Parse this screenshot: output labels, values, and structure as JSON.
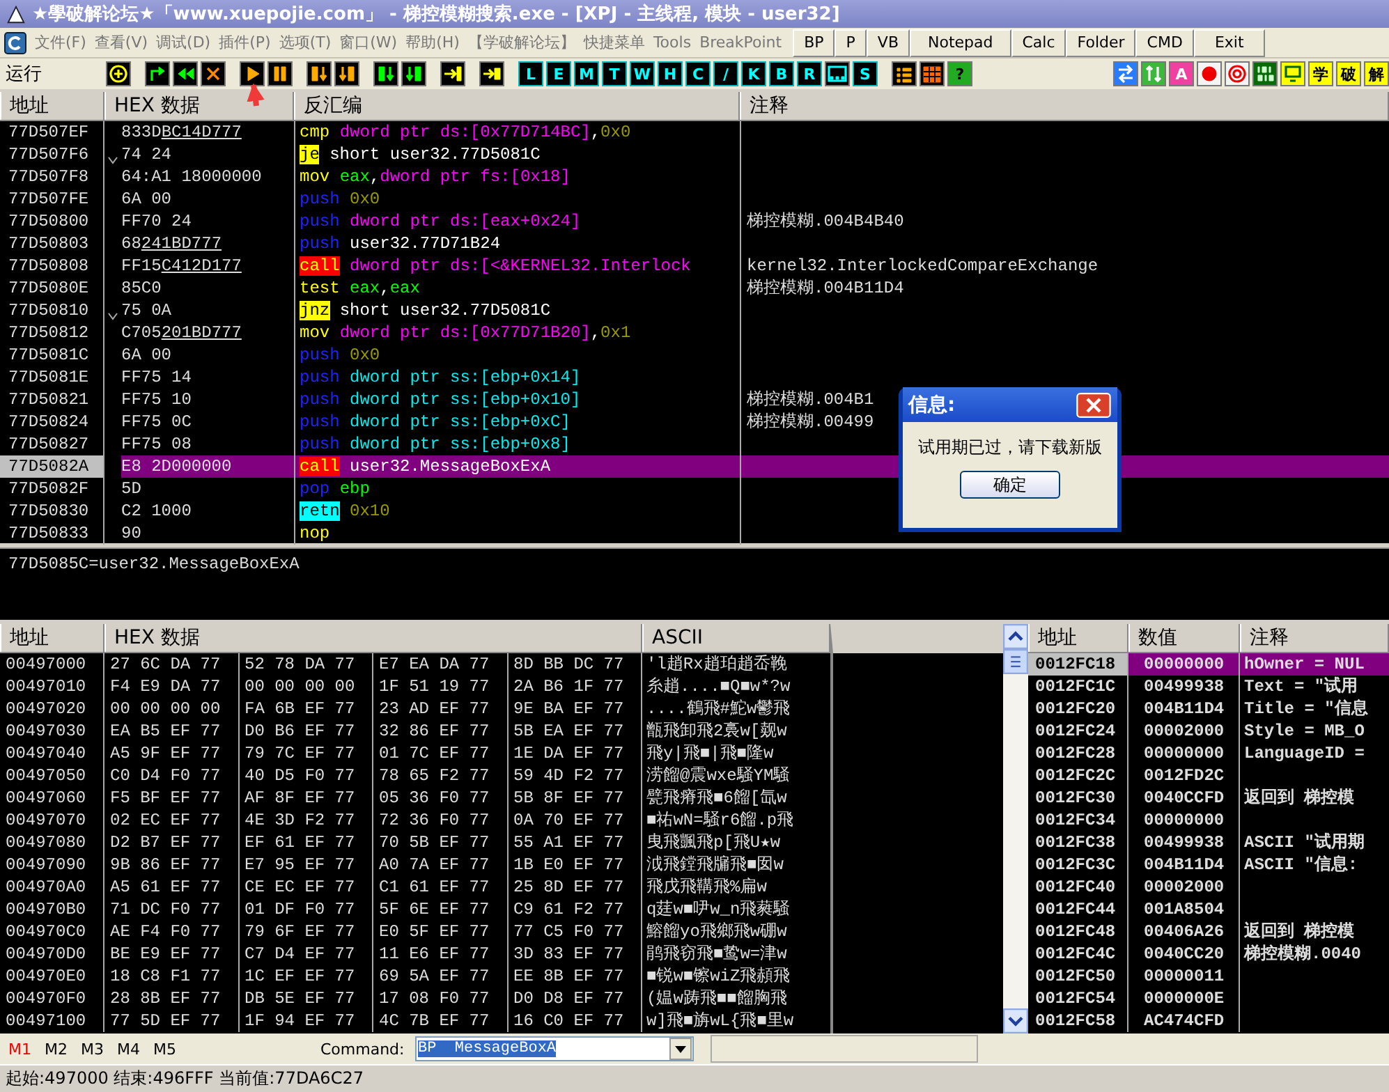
{
  "window": {
    "title": "★學破解论坛★「www.xuepojie.com」 - 梯控模糊搜索.exe - [XPJ - 主线程, 模块 - user32]"
  },
  "menu": {
    "items": [
      "文件(F)",
      "查看(V)",
      "调试(D)",
      "插件(P)",
      "选项(T)",
      "窗口(W)",
      "帮助(H)",
      "【学破解论坛】",
      "快捷菜单",
      "Tools",
      "BreakPoint"
    ],
    "buttons": [
      "BP",
      "P",
      "VB",
      "Notepad",
      "Calc",
      "Folder",
      "CMD",
      "Exit"
    ]
  },
  "toolbar": {
    "label": "运行",
    "groups": [
      [
        {
          "kind": "plus"
        }
      ],
      [
        {
          "kind": "restart"
        },
        {
          "kind": "rewind"
        },
        {
          "kind": "close"
        }
      ],
      [
        {
          "kind": "play"
        },
        {
          "kind": "pause"
        }
      ],
      [
        {
          "kind": "stepin"
        },
        {
          "kind": "stepover"
        }
      ],
      [
        {
          "kind": "tracein"
        },
        {
          "kind": "traceover"
        }
      ],
      [
        {
          "kind": "return"
        }
      ],
      [
        {
          "kind": "goto"
        }
      ],
      [
        {
          "kind": "letter",
          "label": "L"
        },
        {
          "kind": "letter",
          "label": "E"
        },
        {
          "kind": "letter",
          "label": "M"
        },
        {
          "kind": "letter",
          "label": "T"
        },
        {
          "kind": "letter",
          "label": "W"
        },
        {
          "kind": "letter",
          "label": "H"
        },
        {
          "kind": "letter",
          "label": "C"
        },
        {
          "kind": "letter",
          "label": "/"
        },
        {
          "kind": "letter",
          "label": "K"
        },
        {
          "kind": "letter",
          "label": "B"
        },
        {
          "kind": "letter",
          "label": "R"
        },
        {
          "kind": "dots"
        },
        {
          "kind": "letter",
          "label": "S"
        }
      ],
      [
        {
          "kind": "list"
        },
        {
          "kind": "grid"
        },
        {
          "kind": "help",
          "label": "?"
        }
      ]
    ],
    "right": [
      {
        "kind": "swap"
      },
      {
        "kind": "updown"
      },
      {
        "kind": "badge",
        "label": "A"
      },
      {
        "kind": "record"
      },
      {
        "kind": "target"
      },
      {
        "kind": "binary"
      },
      {
        "kind": "monitor"
      },
      {
        "kind": "glyph",
        "label": "学"
      },
      {
        "kind": "glyph",
        "label": "破"
      },
      {
        "kind": "glyph",
        "label": "解"
      }
    ]
  },
  "disasm": {
    "columns": [
      "地址",
      "HEX 数据",
      "反汇编",
      "注释"
    ],
    "rows": [
      {
        "addr": "77D507EF",
        "hex": "833D",
        "fixup": "BC14D777",
        "jump_mark": false,
        "selected": false,
        "asm": [
          {
            "kind": "op",
            "text": "cmp"
          },
          {
            "kind": "mem",
            "text": "dword ptr ds:[0x77D714BC]"
          },
          {
            "kind": "sep",
            "text": ","
          },
          {
            "kind": "imm",
            "text": "0x0"
          }
        ]
      },
      {
        "addr": "77D507F6",
        "hex": "74 24",
        "jump_mark": true,
        "selected": false,
        "asm": [
          {
            "kind": "jcc",
            "text": "je"
          },
          {
            "kind": "sym",
            "text": "short user32.77D5081C"
          }
        ]
      },
      {
        "addr": "77D507F8",
        "hex": "64:A1 18000000",
        "jump_mark": false,
        "selected": false,
        "asm": [
          {
            "kind": "op",
            "text": "mov"
          },
          {
            "kind": "reg",
            "text": "eax"
          },
          {
            "kind": "sep",
            "text": ","
          },
          {
            "kind": "mem",
            "text": "dword ptr fs:[0x18]"
          }
        ]
      },
      {
        "addr": "77D507FE",
        "hex": "6A 00",
        "jump_mark": false,
        "selected": false,
        "asm": [
          {
            "kind": "push",
            "text": "push"
          },
          {
            "kind": "imm",
            "text": "0x0"
          }
        ]
      },
      {
        "addr": "77D50800",
        "hex": "FF70 24",
        "jump_mark": false,
        "selected": false,
        "asm": [
          {
            "kind": "push",
            "text": "push"
          },
          {
            "kind": "mem",
            "text": "dword ptr ds:[eax+0x24]"
          }
        ],
        "comment": "梯控模糊.004B4B40"
      },
      {
        "addr": "77D50803",
        "hex": "68",
        "fixup": "241BD777",
        "jump_mark": false,
        "selected": false,
        "asm": [
          {
            "kind": "push",
            "text": "push"
          },
          {
            "kind": "sym",
            "text": "user32.77D71B24"
          }
        ]
      },
      {
        "addr": "77D50808",
        "hex": "FF15",
        "fixup": "C412D177",
        "jump_mark": false,
        "selected": false,
        "asm": [
          {
            "kind": "call",
            "text": "call"
          },
          {
            "kind": "mem",
            "text": "dword ptr ds:[<&KERNEL32.Interlock"
          }
        ],
        "comment": "kernel32.InterlockedCompareExchange"
      },
      {
        "addr": "77D5080E",
        "hex": "85C0",
        "jump_mark": false,
        "selected": false,
        "asm": [
          {
            "kind": "op",
            "text": "test"
          },
          {
            "kind": "reg",
            "text": "eax"
          },
          {
            "kind": "sep",
            "text": ","
          },
          {
            "kind": "reg",
            "text": "eax"
          }
        ],
        "comment": "梯控模糊.004B11D4"
      },
      {
        "addr": "77D50810",
        "hex": "75 0A",
        "jump_mark": true,
        "selected": false,
        "asm": [
          {
            "kind": "jcc",
            "text": "jnz"
          },
          {
            "kind": "sym",
            "text": "short user32.77D5081C"
          }
        ]
      },
      {
        "addr": "77D50812",
        "hex": "C705",
        "fixup": "201BD777",
        "jump_mark": false,
        "selected": false,
        "asm": [
          {
            "kind": "op",
            "text": "mov"
          },
          {
            "kind": "mem",
            "text": "dword ptr ds:[0x77D71B20]"
          },
          {
            "kind": "sep",
            "text": ","
          },
          {
            "kind": "imm",
            "text": "0x1"
          }
        ]
      },
      {
        "addr": "77D5081C",
        "hex": "6A 00",
        "jump_mark": false,
        "selected": false,
        "asm": [
          {
            "kind": "push",
            "text": "push"
          },
          {
            "kind": "imm",
            "text": "0x0"
          }
        ]
      },
      {
        "addr": "77D5081E",
        "hex": "FF75 14",
        "jump_mark": false,
        "selected": false,
        "asm": [
          {
            "kind": "push",
            "text": "push"
          },
          {
            "kind": "stk",
            "text": "dword ptr ss:[ebp+0x14]"
          }
        ]
      },
      {
        "addr": "77D50821",
        "hex": "FF75 10",
        "jump_mark": false,
        "selected": false,
        "asm": [
          {
            "kind": "push",
            "text": "push"
          },
          {
            "kind": "stk",
            "text": "dword ptr ss:[ebp+0x10]"
          }
        ],
        "comment": "梯控模糊.004B1"
      },
      {
        "addr": "77D50824",
        "hex": "FF75 0C",
        "jump_mark": false,
        "selected": false,
        "asm": [
          {
            "kind": "push",
            "text": "push"
          },
          {
            "kind": "stk",
            "text": "dword ptr ss:[ebp+0xC]"
          }
        ],
        "comment": "梯控模糊.00499"
      },
      {
        "addr": "77D50827",
        "hex": "FF75 08",
        "jump_mark": false,
        "selected": false,
        "asm": [
          {
            "kind": "push",
            "text": "push"
          },
          {
            "kind": "stk",
            "text": "dword ptr ss:[ebp+0x8]"
          }
        ]
      },
      {
        "addr": "77D5082A",
        "hex": "E8 2D000000",
        "jump_mark": false,
        "selected": true,
        "asm": [
          {
            "kind": "call",
            "text": "call"
          },
          {
            "kind": "sym",
            "text": "user32.MessageBoxExA"
          }
        ]
      },
      {
        "addr": "77D5082F",
        "hex": "5D",
        "jump_mark": false,
        "selected": false,
        "asm": [
          {
            "kind": "push",
            "text": "pop"
          },
          {
            "kind": "reg",
            "text": "ebp"
          }
        ]
      },
      {
        "addr": "77D50830",
        "hex": "C2 1000",
        "jump_mark": false,
        "selected": false,
        "asm": [
          {
            "kind": "ret",
            "text": "retn"
          },
          {
            "kind": "imm",
            "text": "0x10"
          }
        ]
      },
      {
        "addr": "77D50833",
        "hex": "90",
        "jump_mark": false,
        "selected": false,
        "asm": [
          {
            "kind": "op",
            "text": "nop"
          }
        ]
      }
    ]
  },
  "info": "77D5085C=user32.MessageBoxExA",
  "dump": {
    "columns": [
      "地址",
      "HEX 数据",
      "ASCII"
    ],
    "rows": [
      {
        "addr": "00497000",
        "groups": [
          "27 6C DA 77",
          "52 78 DA 77",
          "E7 EA DA 77",
          "8D BB DC 77"
        ],
        "ascii": "'l趙Rx趙珀趙岙鞔"
      },
      {
        "addr": "00497010",
        "groups": [
          "F4 E9 DA 77",
          "00 00 00 00",
          "1F 51 19 77",
          "2A B6 1F 77"
        ],
        "ascii": "糸趙....■Q■w*?w"
      },
      {
        "addr": "00497020",
        "groups": [
          "00 00 00 00",
          "FA 6B EF 77",
          "23 AD EF 77",
          "9E BA EF 77"
        ],
        "ascii": "....鶴飛#鮀w鬱飛"
      },
      {
        "addr": "00497030",
        "groups": [
          "EA B5 EF 77",
          "D0 B6 EF 77",
          "32 86 EF 77",
          "5B EA EF 77"
        ],
        "ascii": "甑飛卸飛2裛w[觌w"
      },
      {
        "addr": "00497040",
        "groups": [
          "A5 9F EF 77",
          "79 7C EF 77",
          "01 7C EF 77",
          "1E DA EF 77"
        ],
        "ascii": "飛y|飛■|飛■隆w"
      },
      {
        "addr": "00497050",
        "groups": [
          "C0 D4 F0 77",
          "40 D5 F0 77",
          "78 65 F2 77",
          "59 4D F2 77"
        ],
        "ascii": "涝餾@震wxe騒YM騒"
      },
      {
        "addr": "00497060",
        "groups": [
          "F5 BF EF 77",
          "AF 8F EF 77",
          "05 36 F0 77",
          "5B 8F EF 77"
        ],
        "ascii": "甓飛瘠飛■6餾[氙w"
      },
      {
        "addr": "00497070",
        "groups": [
          "02 EC EF 77",
          "4E 3D F2 77",
          "72 36 F0 77",
          "0A 70 EF 77"
        ],
        "ascii": "■祐wN=騒r6餾.p飛"
      },
      {
        "addr": "00497080",
        "groups": [
          "D2 B7 EF 77",
          "EF 61 EF 77",
          "70 5B EF 77",
          "55 A1 EF 77"
        ],
        "ascii": "曳飛颽飛p[飛U★w"
      },
      {
        "addr": "00497090",
        "groups": [
          "9B 86 EF 77",
          "E7 95 EF 77",
          "A0 7A EF 77",
          "1B E0 EF 77"
        ],
        "ascii": "泧飛鏜飛牖飛■囡w"
      },
      {
        "addr": "004970A0",
        "groups": [
          "A5 61 EF 77",
          "CE EC EF 77",
          "C1 61 EF 77",
          "25 8D EF 77"
        ],
        "ascii": "飛戊飛鞲飛%扁w"
      },
      {
        "addr": "004970B0",
        "groups": [
          "71 DC F0 77",
          "01 DF F0 77",
          "5F 6E EF 77",
          "C9 61 F2 77"
        ],
        "ascii": "q莛w■吚w_n飛蕤騒"
      },
      {
        "addr": "004970C0",
        "groups": [
          "AE F4 F0 77",
          "79 6F EF 77",
          "E0 5F EF 77",
          "77 C5 F0 77"
        ],
        "ascii": "鰫餾yo飛鄉飛w硼w"
      },
      {
        "addr": "004970D0",
        "groups": [
          "BE E9 EF 77",
          "C7 D4 EF 77",
          "11 E6 EF 77",
          "3D 83 EF 77"
        ],
        "ascii": "鹃飛窃飛■鸷w=津w"
      },
      {
        "addr": "004970E0",
        "groups": [
          "18 C8 F1 77",
          "1C EF EF 77",
          "69 5A EF 77",
          "EE 8B EF 77"
        ],
        "ascii": "■锐w■镲wiZ飛頳飛"
      },
      {
        "addr": "004970F0",
        "groups": [
          "28 8B EF 77",
          "DB 5E EF 77",
          "17 08 F0 77",
          "D0 D8 EF 77"
        ],
        "ascii": "(媪w踌飛■■餾胸飛"
      },
      {
        "addr": "00497100",
        "groups": [
          "77 5D EF 77",
          "1F 94 EF 77",
          "4C 7B EF 77",
          "16 C0 EF 77"
        ],
        "ascii": "w]飛■旃wL{飛■里w"
      }
    ]
  },
  "stack": {
    "columns": [
      "地址",
      "数值",
      "注释"
    ],
    "rows": [
      {
        "addr": "0012FC18",
        "value": "00000000",
        "comment": "hOwner = NUL",
        "selected": true
      },
      {
        "addr": "0012FC1C",
        "value": "00499938",
        "comment": "Text = \"试用",
        "selected": false
      },
      {
        "addr": "0012FC20",
        "value": "004B11D4",
        "comment": "Title = \"信息",
        "selected": false
      },
      {
        "addr": "0012FC24",
        "value": "00002000",
        "comment": "Style = MB_O",
        "selected": false
      },
      {
        "addr": "0012FC28",
        "value": "00000000",
        "comment": "LanguageID =",
        "selected": false
      },
      {
        "addr": "0012FC2C",
        "value": "0012FD2C",
        "selected": false
      },
      {
        "addr": "0012FC30",
        "value": "0040CCFD",
        "comment": "返回到 梯控模",
        "selected": false
      },
      {
        "addr": "0012FC34",
        "value": "00000000",
        "selected": false
      },
      {
        "addr": "0012FC38",
        "value": "00499938",
        "comment": "ASCII \"试用期",
        "selected": false
      },
      {
        "addr": "0012FC3C",
        "value": "004B11D4",
        "comment": "ASCII \"信息:",
        "selected": false
      },
      {
        "addr": "0012FC40",
        "value": "00002000",
        "selected": false
      },
      {
        "addr": "0012FC44",
        "value": "001A8504",
        "selected": false
      },
      {
        "addr": "0012FC48",
        "value": "00406A26",
        "comment": "返回到 梯控模",
        "selected": false
      },
      {
        "addr": "0012FC4C",
        "value": "0040CC20",
        "comment": "梯控模糊.0040",
        "selected": false
      },
      {
        "addr": "0012FC50",
        "value": "00000011",
        "selected": false
      },
      {
        "addr": "0012FC54",
        "value": "0000000E",
        "selected": false
      },
      {
        "addr": "0012FC58",
        "value": "AC474CFD",
        "selected": false
      }
    ]
  },
  "command": {
    "tabs": [
      {
        "label": "M1",
        "selected": true
      },
      {
        "label": "M2",
        "selected": false
      },
      {
        "label": "M3",
        "selected": false
      },
      {
        "label": "M4",
        "selected": false
      },
      {
        "label": "M5",
        "selected": false
      }
    ],
    "label": "Command:",
    "value": "BP  MessageBoxA"
  },
  "status": "起始:497000 结束:496FFF 当前值:77DA6C27",
  "dialog": {
    "title": "信息:",
    "message": "试用期已过，请下载新版",
    "button": "确定"
  }
}
